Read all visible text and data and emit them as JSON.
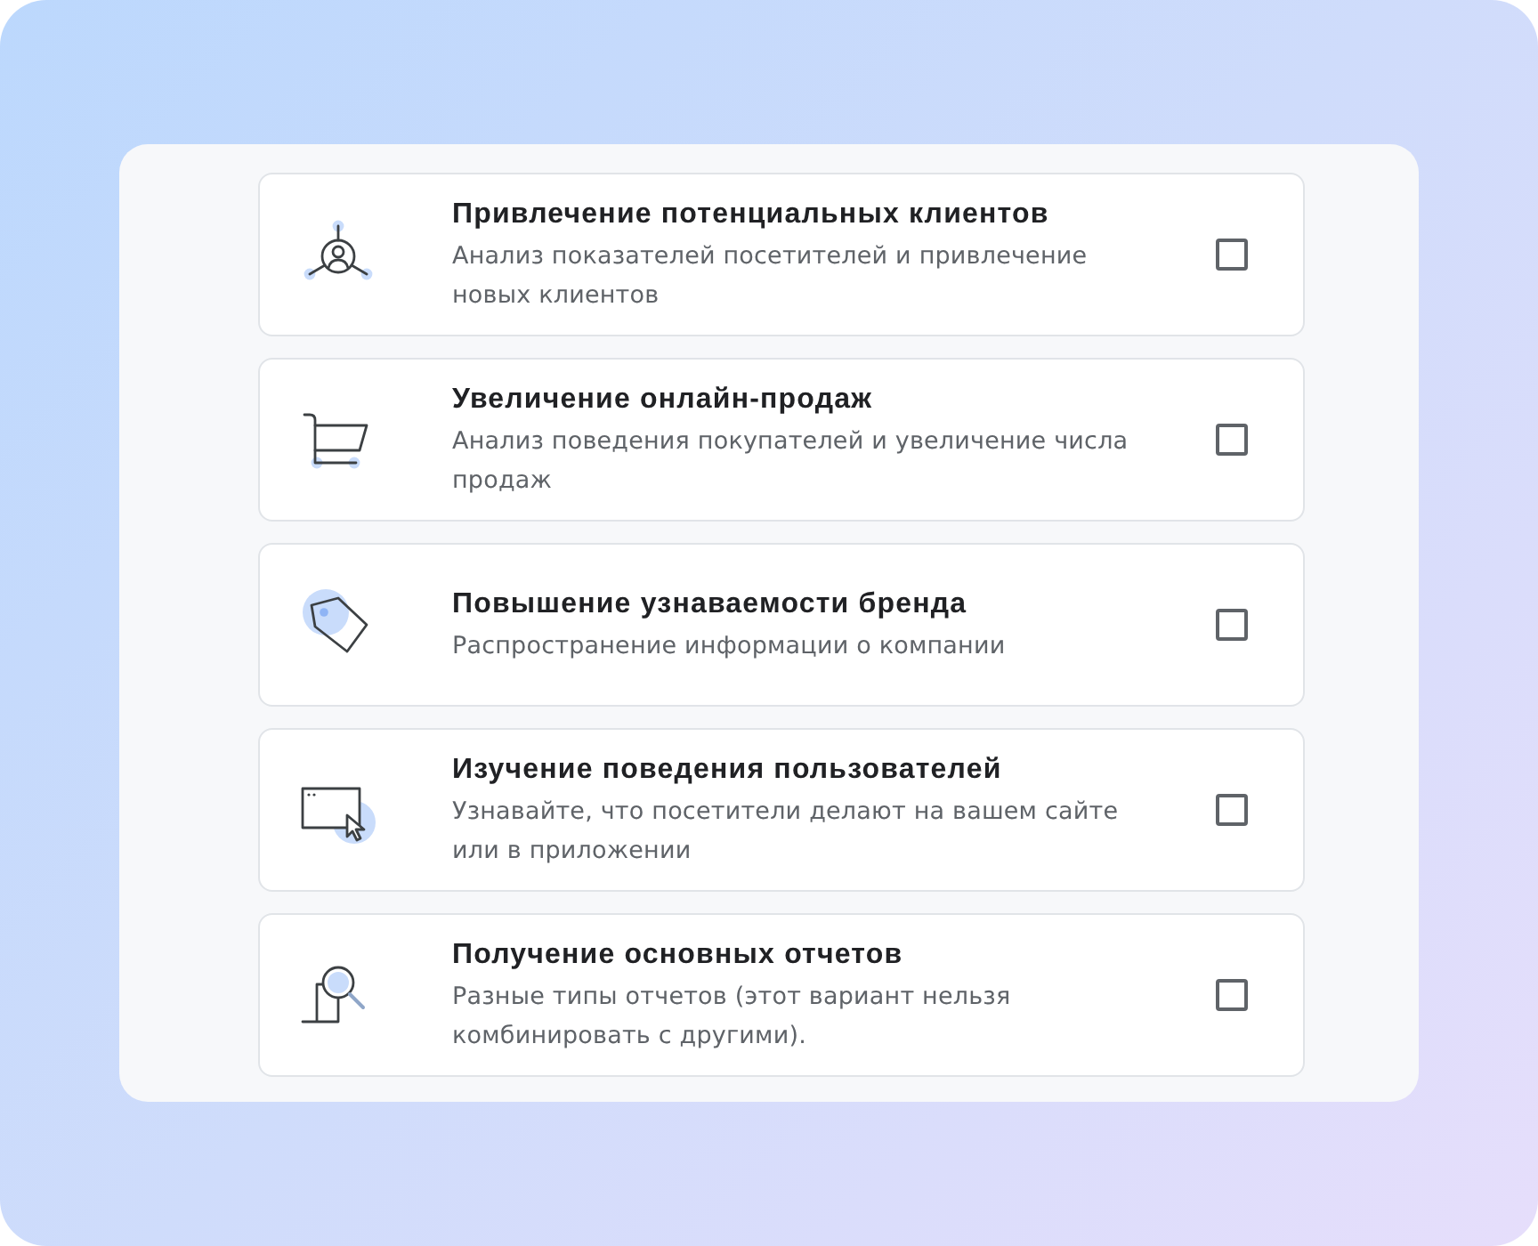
{
  "options": [
    {
      "kind": "leads",
      "title": "Привлечение потенциальных клиентов",
      "description": "Анализ показателей посетителей и привлечение новых клиентов",
      "checked": false
    },
    {
      "kind": "sales",
      "title": "Увеличение онлайн-продаж",
      "description": "Анализ поведения покупателей и увеличение числа продаж",
      "checked": false
    },
    {
      "kind": "brand",
      "title": "Повышение узнаваемости бренда",
      "description": "Распространение информации о компании",
      "checked": false
    },
    {
      "kind": "behavior",
      "title": "Изучение поведения пользователей",
      "description": "Узнавайте, что посетители делают на вашем сайте или в приложении",
      "checked": false
    },
    {
      "kind": "reports",
      "title": "Получение основных отчетов",
      "description": "Разные типы отчетов (этот вариант нельзя комбинировать с другими).",
      "checked": false
    }
  ]
}
